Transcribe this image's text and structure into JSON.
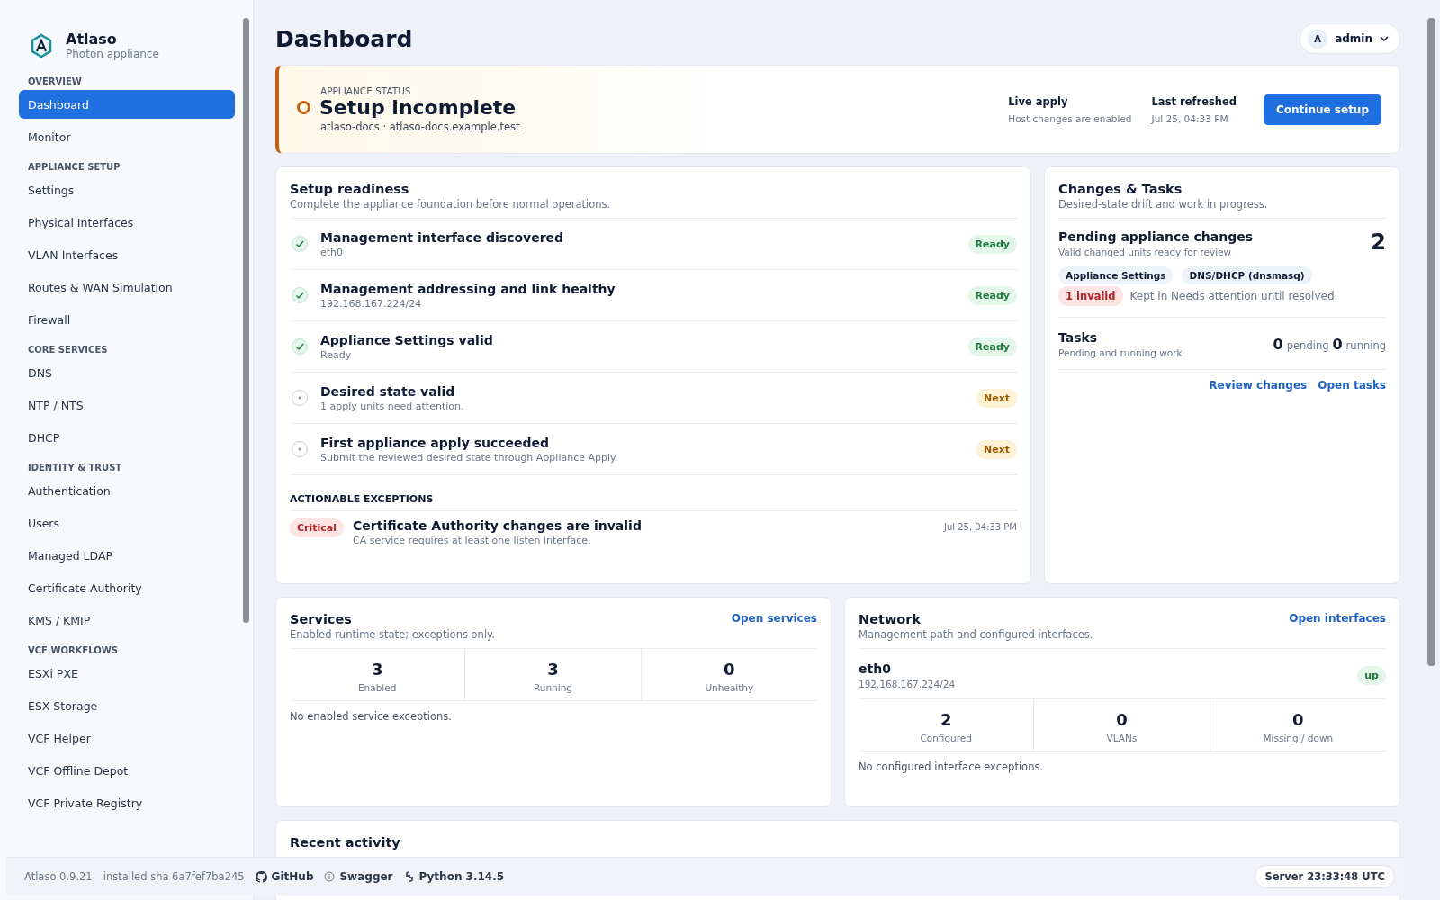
{
  "brand": {
    "name": "Atlaso",
    "subtitle": "Photon appliance"
  },
  "sidebar": {
    "sections": [
      {
        "title": "OVERVIEW",
        "items": [
          {
            "label": "Dashboard",
            "selected": true
          },
          {
            "label": "Monitor",
            "selected": false
          }
        ]
      },
      {
        "title": "APPLIANCE SETUP",
        "items": [
          {
            "label": "Settings",
            "selected": false
          },
          {
            "label": "Physical Interfaces",
            "selected": false
          },
          {
            "label": "VLAN Interfaces",
            "selected": false
          },
          {
            "label": "Routes & WAN Simulation",
            "selected": false
          },
          {
            "label": "Firewall",
            "selected": false
          }
        ]
      },
      {
        "title": "CORE SERVICES",
        "items": [
          {
            "label": "DNS",
            "selected": false
          },
          {
            "label": "NTP / NTS",
            "selected": false
          },
          {
            "label": "DHCP",
            "selected": false
          }
        ]
      },
      {
        "title": "IDENTITY & TRUST",
        "items": [
          {
            "label": "Authentication",
            "selected": false
          },
          {
            "label": "Users",
            "selected": false
          },
          {
            "label": "Managed LDAP",
            "selected": false
          },
          {
            "label": "Certificate Authority",
            "selected": false
          },
          {
            "label": "KMS / KMIP",
            "selected": false
          }
        ]
      },
      {
        "title": "VCF WORKFLOWS",
        "items": [
          {
            "label": "ESXi PXE",
            "selected": false
          },
          {
            "label": "ESX Storage",
            "selected": false
          },
          {
            "label": "VCF Helper",
            "selected": false
          },
          {
            "label": "VCF Offline Depot",
            "selected": false
          },
          {
            "label": "VCF Private Registry",
            "selected": false
          }
        ]
      }
    ]
  },
  "page_title": "Dashboard",
  "user": {
    "initial": "A",
    "name": "admin"
  },
  "status": {
    "eyebrow": "APPLIANCE STATUS",
    "title": "Setup incomplete",
    "host": "atlaso-docs · atlaso-docs.example.test",
    "facts": [
      {
        "label": "Live apply",
        "value": "Host changes are enabled"
      },
      {
        "label": "Last refreshed",
        "value": "Jul 25, 04:33 PM"
      }
    ],
    "action": "Continue setup"
  },
  "readiness": {
    "title": "Setup readiness",
    "subtitle": "Complete the appliance foundation before normal operations.",
    "steps": [
      {
        "kind": "ready",
        "title": "Management interface discovered",
        "detail": "eth0",
        "badge": "Ready"
      },
      {
        "kind": "ready",
        "title": "Management addressing and link healthy",
        "detail": "192.168.167.224/24",
        "badge": "Ready"
      },
      {
        "kind": "ready",
        "title": "Appliance Settings valid",
        "detail": "Ready",
        "badge": "Ready"
      },
      {
        "kind": "next",
        "title": "Desired state valid",
        "detail": "1 apply units need attention.",
        "badge": "Next"
      },
      {
        "kind": "next",
        "title": "First appliance apply succeeded",
        "detail": "Submit the reviewed desired state through Appliance Apply.",
        "badge": "Next"
      }
    ],
    "exceptions_title": "ACTIONABLE EXCEPTIONS",
    "exceptions": [
      {
        "severity": "Critical",
        "title": "Certificate Authority changes are invalid",
        "detail": "CA service requires at least one listen interface.",
        "time": "Jul 25, 04:33 PM"
      }
    ]
  },
  "changes": {
    "title": "Changes & Tasks",
    "subtitle": "Desired-state drift and work in progress.",
    "pending": {
      "title": "Pending appliance changes",
      "subtitle": "Valid changed units ready for review",
      "count": "2",
      "tags": [
        "Appliance Settings",
        "DNS/DHCP (dnsmasq)"
      ],
      "invalid": "1 invalid",
      "invalid_note": "Kept in Needs attention until resolved."
    },
    "tasks": {
      "title": "Tasks",
      "subtitle": "Pending and running work",
      "pending_count": "0",
      "pending_label": "pending",
      "running_count": "0",
      "running_label": "running"
    },
    "links": [
      "Review changes",
      "Open tasks"
    ]
  },
  "services": {
    "title": "Services",
    "subtitle": "Enabled runtime state; exceptions only.",
    "link": "Open services",
    "stats": [
      {
        "value": "3",
        "label": "Enabled"
      },
      {
        "value": "3",
        "label": "Running"
      },
      {
        "value": "0",
        "label": "Unhealthy"
      }
    ],
    "note": "No enabled service exceptions."
  },
  "network": {
    "title": "Network",
    "subtitle": "Management path and configured interfaces.",
    "link": "Open interfaces",
    "interface": {
      "name": "eth0",
      "address": "192.168.167.224/24",
      "state": "up"
    },
    "stats": [
      {
        "value": "2",
        "label": "Configured"
      },
      {
        "value": "0",
        "label": "VLANs"
      },
      {
        "value": "0",
        "label": "Missing / down"
      }
    ],
    "note": "No configured interface exceptions."
  },
  "recent": {
    "title": "Recent activity"
  },
  "footer": {
    "version": "Atlaso 0.9.21",
    "sha": "installed sha 6a7fef7ba245",
    "links": [
      {
        "kind": "github",
        "label": "GitHub"
      },
      {
        "kind": "swagger",
        "label": "Swagger"
      },
      {
        "kind": "python",
        "label": "Python 3.14.5"
      }
    ],
    "server": "Server 23:33:48 UTC"
  }
}
